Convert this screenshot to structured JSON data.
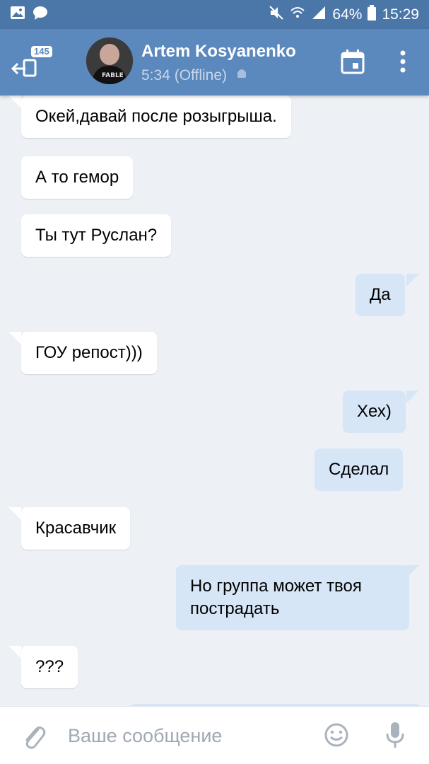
{
  "status_bar": {
    "battery": "64%",
    "time": "15:29"
  },
  "header": {
    "back_badge": "145",
    "contact_name": "Artem Kosyanenko",
    "contact_status": "5:34 (Offline)"
  },
  "messages": [
    {
      "dir": "in",
      "text": "Окей,давай после розыгрыша."
    },
    {
      "dir": "in",
      "text": "А то гемор"
    },
    {
      "dir": "in",
      "text": "Ты тут Руслан?"
    },
    {
      "dir": "out",
      "text": "Да"
    },
    {
      "dir": "in",
      "text": "ГОУ репост)))"
    },
    {
      "dir": "out",
      "text": "Хех)"
    },
    {
      "dir": "out",
      "text": "Сделал"
    },
    {
      "dir": "in",
      "text": "Красавчик"
    },
    {
      "dir": "out",
      "text": "Но группа может твоя пострадать"
    },
    {
      "dir": "in",
      "text": "???"
    }
  ],
  "composer": {
    "placeholder": "Ваше сообщение"
  },
  "colors": {
    "toolbar": "#5b88bd",
    "statusbar": "#4a76a8",
    "incoming_bubble": "#ffffff",
    "outgoing_bubble": "#d7e6f7",
    "chat_background": "#edf0f4"
  }
}
